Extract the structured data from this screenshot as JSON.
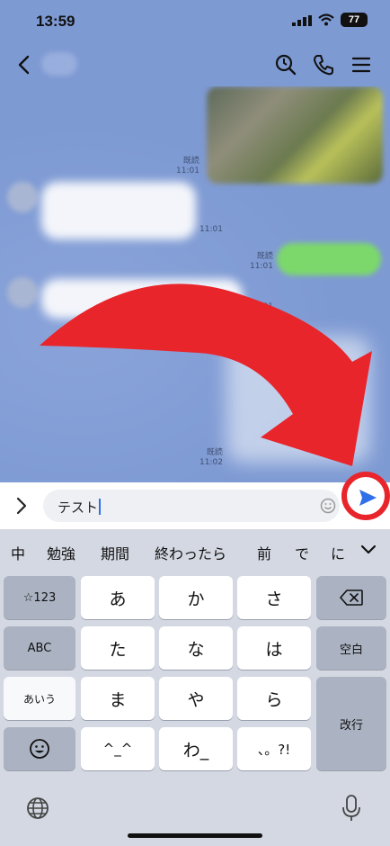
{
  "status": {
    "time": "13:59",
    "battery": "77"
  },
  "header": {
    "icons": [
      "back-chevron-icon",
      "search-icon",
      "phone-icon",
      "menu-icon"
    ]
  },
  "chat": {
    "messages": [
      {
        "side": "out",
        "kind": "image",
        "meta": [
          "既読",
          "11:01"
        ]
      },
      {
        "side": "in",
        "kind": "text",
        "meta": [
          "11:01"
        ]
      },
      {
        "side": "out",
        "kind": "text",
        "meta": [
          "既読",
          "11:01"
        ]
      },
      {
        "side": "in",
        "kind": "text",
        "meta": [
          "11:01"
        ]
      },
      {
        "side": "out",
        "kind": "text",
        "meta": [
          "既読",
          "11:02"
        ]
      }
    ],
    "annotation": {
      "arrow_color": "#e8252b",
      "circle_color": "#e8252b"
    }
  },
  "input": {
    "value": "テスト"
  },
  "suggestions": [
    "中",
    "勉強",
    "期間",
    "終わったら",
    "前",
    "で",
    "に"
  ],
  "keyboard": {
    "left_keys": [
      "☆123",
      "ABC",
      "あいう"
    ],
    "grid": [
      "あ",
      "か",
      "さ",
      "た",
      "な",
      "は",
      "ま",
      "や",
      "ら",
      "^_^",
      "わ_",
      "、。?!"
    ],
    "space_label": "空白",
    "return_label": "改行"
  },
  "colors": {
    "accent": "#2f6fe8",
    "chat_bg": "#7e9ad3",
    "outgoing_bubble": "#7cd86a"
  }
}
